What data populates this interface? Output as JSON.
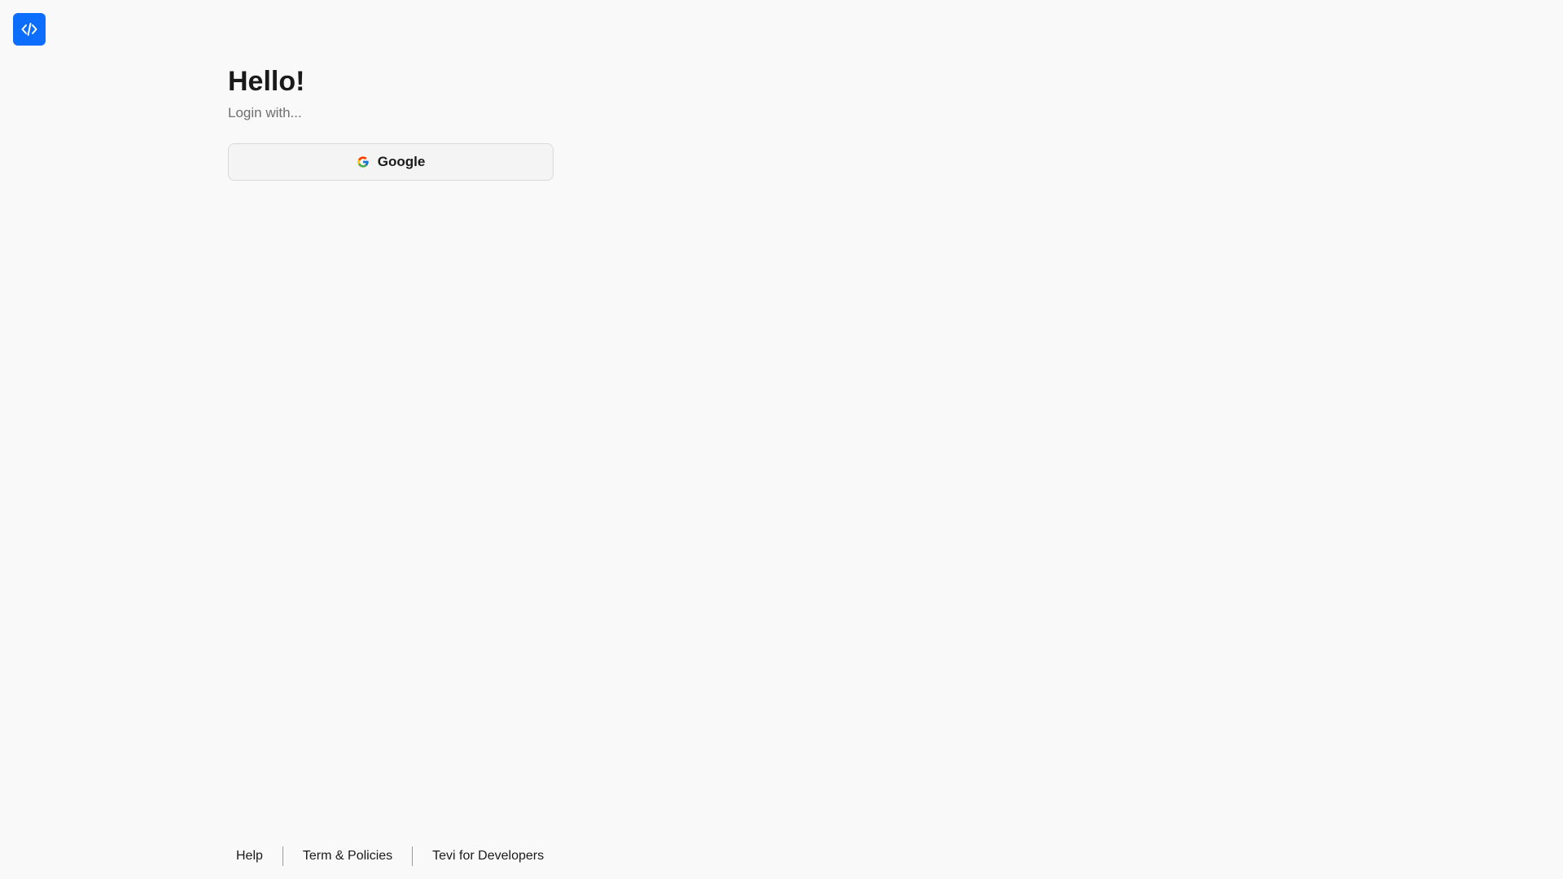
{
  "app": {
    "logo_icon": "code-brackets-icon",
    "logo_color": "#0d6efd"
  },
  "login": {
    "title": "Hello!",
    "subtitle": "Login with...",
    "providers": [
      {
        "label": "Google",
        "icon": "google-g-icon"
      }
    ]
  },
  "footer": {
    "links": [
      {
        "label": "Help"
      },
      {
        "label": "Term & Policies"
      },
      {
        "label": "Tevi for Developers"
      }
    ]
  }
}
